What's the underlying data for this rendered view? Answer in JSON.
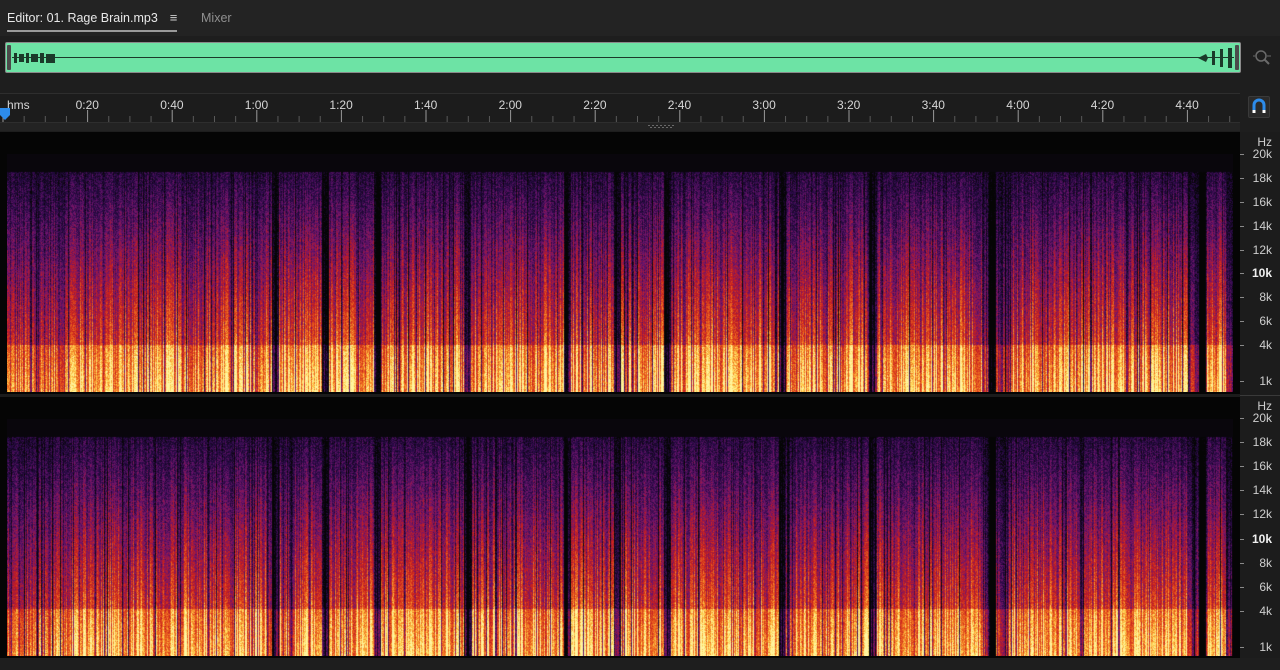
{
  "tabs": {
    "editor_label": "Editor: 01. Rage Brain.mp3",
    "editor_menu_glyph": "≡",
    "mixer_label": "Mixer"
  },
  "ruler": {
    "units_label": "hms",
    "time_labels": [
      "0:20",
      "0:40",
      "1:00",
      "1:20",
      "1:40",
      "2:00",
      "2:20",
      "2:40",
      "3:00",
      "3:20",
      "3:40",
      "4:00",
      "4:20",
      "4:40"
    ]
  },
  "frequency_axis": {
    "unit_label": "Hz",
    "labels": [
      "20k",
      "18k",
      "16k",
      "14k",
      "12k",
      "10k",
      "8k",
      "6k",
      "4k",
      "1k"
    ],
    "bold_labels": [
      "10k"
    ]
  },
  "icons": {
    "zoom": "zoom-magnifier-icon",
    "snap": "snapping-magnet-icon",
    "playhead": "playhead-marker-icon",
    "menu": "panel-menu-icon"
  },
  "colors": {
    "overview_waveform": "#6de3a5",
    "spectrogram_low": "#2a0a40",
    "spectrogram_mid": "#c81e1e",
    "spectrogram_high": "#ffe680",
    "snap_accent": "#2d8ceb"
  }
}
